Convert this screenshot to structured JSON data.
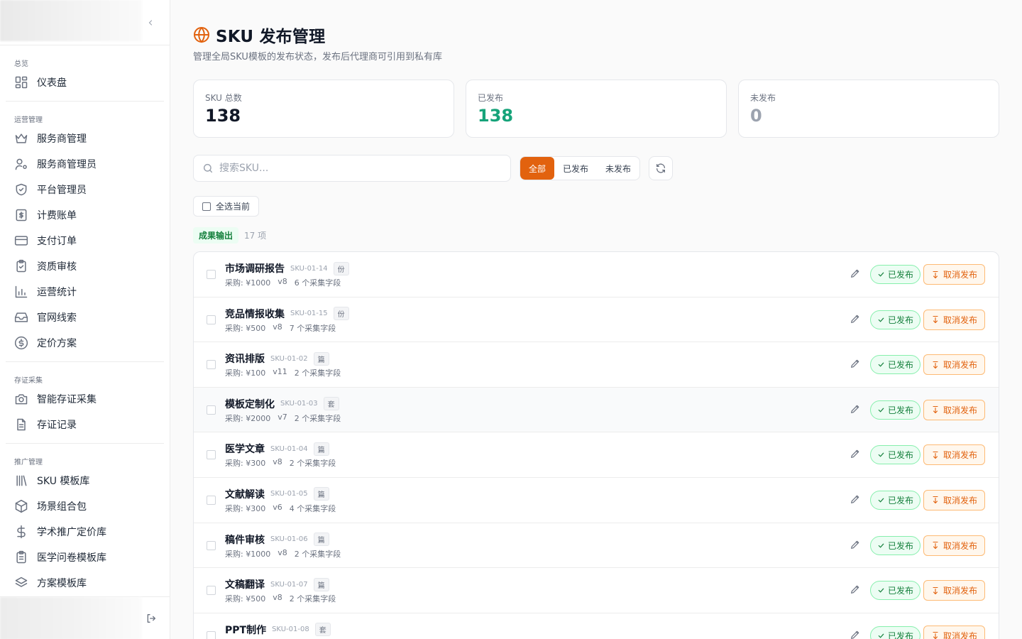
{
  "sidebar": {
    "groups": [
      {
        "title": "总览",
        "items": [
          {
            "label": "仪表盘",
            "icon": "dashboard-icon"
          }
        ]
      },
      {
        "title": "运营管理",
        "items": [
          {
            "label": "服务商管理",
            "icon": "crown-icon"
          },
          {
            "label": "服务商管理员",
            "icon": "user-gear-icon"
          },
          {
            "label": "平台管理员",
            "icon": "shield-icon"
          },
          {
            "label": "计费账单",
            "icon": "bill-icon"
          },
          {
            "label": "支付订单",
            "icon": "credit-card-icon"
          },
          {
            "label": "资质审核",
            "icon": "clipboard-check-icon"
          },
          {
            "label": "运营统计",
            "icon": "bar-chart-icon"
          },
          {
            "label": "官网线索",
            "icon": "inbox-icon"
          },
          {
            "label": "定价方案",
            "icon": "dollar-circle-icon"
          }
        ]
      },
      {
        "title": "存证采集",
        "items": [
          {
            "label": "智能存证采集",
            "icon": "camera-icon"
          },
          {
            "label": "存证记录",
            "icon": "file-text-icon"
          }
        ]
      },
      {
        "title": "推广管理",
        "items": [
          {
            "label": "SKU 模板库",
            "icon": "library-icon"
          },
          {
            "label": "场景组合包",
            "icon": "package-icon"
          },
          {
            "label": "学术推广定价库",
            "icon": "dollar-icon"
          },
          {
            "label": "医学问卷模板库",
            "icon": "clipboard-list-icon"
          },
          {
            "label": "方案模板库",
            "icon": "layers-icon"
          }
        ]
      }
    ]
  },
  "header": {
    "title": "SKU 发布管理",
    "subtitle": "管理全局SKU模板的发布状态，发布后代理商可引用到私有库",
    "icon": "globe-icon"
  },
  "stats": [
    {
      "label": "SKU 总数",
      "value": "138",
      "color": "#111827"
    },
    {
      "label": "已发布",
      "value": "138",
      "color": "#16a37a"
    },
    {
      "label": "未发布",
      "value": "0",
      "color": "#9ca3af"
    }
  ],
  "search": {
    "placeholder": "搜索SKU...",
    "value": ""
  },
  "filters": {
    "options": [
      "全部",
      "已发布",
      "未发布"
    ],
    "active": "全部",
    "accent": "#e2620e"
  },
  "select_all_label": "全选当前",
  "group": {
    "name": "成果输出",
    "count": "17 项"
  },
  "rows": [
    {
      "name": "市场调研报告",
      "code": "SKU-01-14",
      "unit": "份",
      "price": "采购: ¥1000",
      "version": "v8",
      "fields": "6 个采集字段",
      "status": "已发布",
      "action": "取消发布"
    },
    {
      "name": "竞品情报收集",
      "code": "SKU-01-15",
      "unit": "份",
      "price": "采购: ¥500",
      "version": "v8",
      "fields": "7 个采集字段",
      "status": "已发布",
      "action": "取消发布"
    },
    {
      "name": "资讯排版",
      "code": "SKU-01-02",
      "unit": "篇",
      "price": "采购: ¥100",
      "version": "v11",
      "fields": "2 个采集字段",
      "status": "已发布",
      "action": "取消发布"
    },
    {
      "name": "模板定制化",
      "code": "SKU-01-03",
      "unit": "套",
      "price": "采购: ¥2000",
      "version": "v7",
      "fields": "2 个采集字段",
      "status": "已发布",
      "action": "取消发布"
    },
    {
      "name": "医学文章",
      "code": "SKU-01-04",
      "unit": "篇",
      "price": "采购: ¥300",
      "version": "v8",
      "fields": "2 个采集字段",
      "status": "已发布",
      "action": "取消发布"
    },
    {
      "name": "文献解读",
      "code": "SKU-01-05",
      "unit": "篇",
      "price": "采购: ¥300",
      "version": "v6",
      "fields": "4 个采集字段",
      "status": "已发布",
      "action": "取消发布"
    },
    {
      "name": "稿件审核",
      "code": "SKU-01-06",
      "unit": "篇",
      "price": "采购: ¥1000",
      "version": "v8",
      "fields": "2 个采集字段",
      "status": "已发布",
      "action": "取消发布"
    },
    {
      "name": "文稿翻译",
      "code": "SKU-01-07",
      "unit": "篇",
      "price": "采购: ¥500",
      "version": "v8",
      "fields": "2 个采集字段",
      "status": "已发布",
      "action": "取消发布"
    },
    {
      "name": "PPT制作",
      "code": "SKU-01-08",
      "unit": "套",
      "price": "",
      "version": "",
      "fields": "",
      "status": "已发布",
      "action": "取消发布"
    }
  ]
}
